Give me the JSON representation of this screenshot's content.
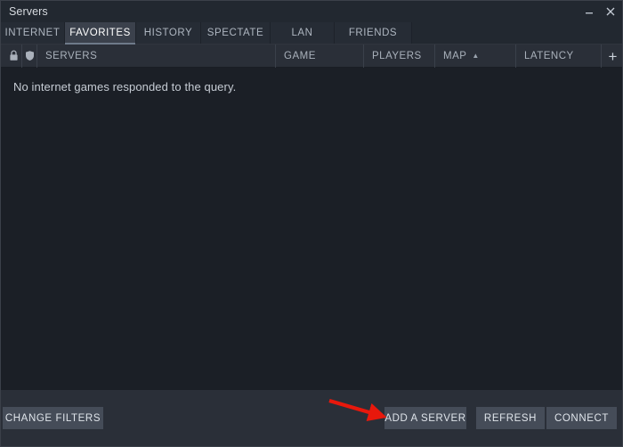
{
  "window": {
    "title": "Servers",
    "minimize_label": "minimize",
    "close_label": "close"
  },
  "tabs": [
    {
      "label": "INTERNET",
      "active": false
    },
    {
      "label": "FAVORITES",
      "active": true
    },
    {
      "label": "HISTORY",
      "active": false
    },
    {
      "label": "SPECTATE",
      "active": false
    },
    {
      "label": "LAN",
      "active": false
    },
    {
      "label": "FRIENDS",
      "active": false
    }
  ],
  "columns": {
    "lock_icon": "lock-icon",
    "shield_icon": "shield-icon",
    "servers": "SERVERS",
    "game": "GAME",
    "players": "PLAYERS",
    "map": "MAP",
    "map_sort": "▲",
    "latency": "LATENCY",
    "add_column": "+"
  },
  "list": {
    "empty_message": "No internet games responded to the query.",
    "rows": []
  },
  "footer": {
    "change_filters": "CHANGE FILTERS",
    "add_a_server": "ADD A SERVER",
    "refresh": "REFRESH",
    "connect": "CONNECT"
  },
  "annotation": {
    "arrow_color": "#e8180c",
    "points_to": "ADD A SERVER"
  },
  "colors": {
    "window_bg": "#23272f",
    "titlebar_bg": "#222830",
    "tab_bg": "#262c35",
    "tab_active_bg": "#3b414c",
    "header_bg": "#2a2f38",
    "list_bg": "#1b1f26",
    "footer_bg": "#2a2f38",
    "button_bg": "#454c58",
    "text_primary": "#dfe4ea",
    "text_secondary": "#a9b1bb"
  }
}
